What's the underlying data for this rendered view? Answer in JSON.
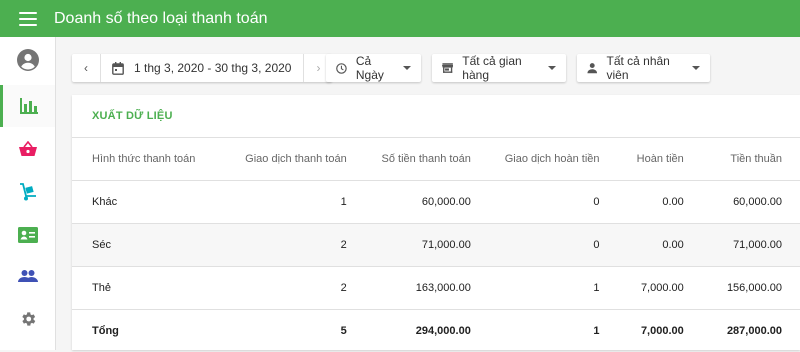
{
  "header": {
    "title": "Doanh số theo loại thanh toán"
  },
  "filters": {
    "date_range": "1 thg 3, 2020 - 30 thg 3, 2020",
    "time": "Cả Ngày",
    "store": "Tất cả gian hàng",
    "employee": "Tất cả nhân viên"
  },
  "report": {
    "export_label": "XUẤT DỮ LIỆU",
    "columns": [
      "Hình thức thanh toán",
      "Giao dịch thanh toán",
      "Số tiền thanh toán",
      "Giao dịch hoàn tiền",
      "Hoàn tiền",
      "Tiền thuần"
    ],
    "rows": [
      [
        "Khác",
        "1",
        "60,000.00",
        "0",
        "0.00",
        "60,000.00"
      ],
      [
        "Séc",
        "2",
        "71,000.00",
        "0",
        "0.00",
        "71,000.00"
      ],
      [
        "Thẻ",
        "2",
        "163,000.00",
        "1",
        "7,000.00",
        "156,000.00"
      ],
      [
        "Tổng",
        "5",
        "294,000.00",
        "1",
        "7,000.00",
        "287,000.00"
      ]
    ]
  },
  "colors": {
    "brand": "#4caf50",
    "pink": "#e91e63",
    "teal": "#00acc1",
    "indigo": "#3f51b5",
    "grey_icon": "#757575"
  }
}
